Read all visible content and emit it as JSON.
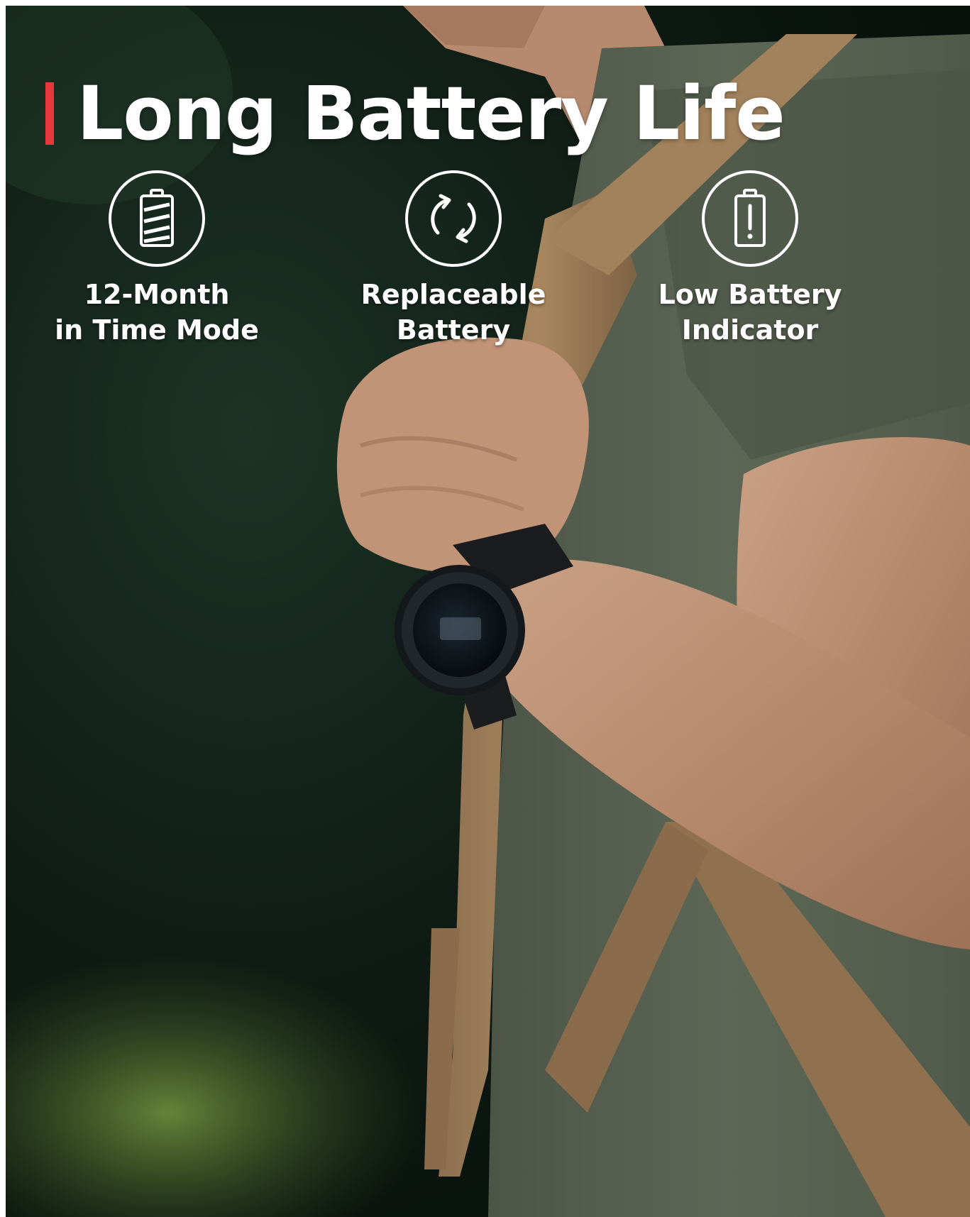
{
  "headline": {
    "title": "Long Battery Life"
  },
  "colors": {
    "accent": "#e8363d",
    "text": "#ffffff"
  },
  "features": [
    {
      "icon": "battery-stripes-icon",
      "label_line1": "12-Month",
      "label_line2": "in Time Mode"
    },
    {
      "icon": "replace-cycle-icon",
      "label_line1": "Replaceable",
      "label_line2": "Battery"
    },
    {
      "icon": "low-battery-alert-icon",
      "label_line1": "Low Battery",
      "label_line2": "Indicator"
    }
  ]
}
